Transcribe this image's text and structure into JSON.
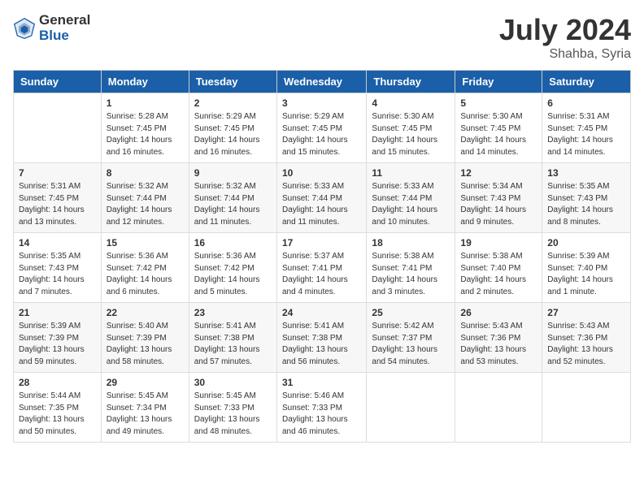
{
  "header": {
    "logo_general": "General",
    "logo_blue": "Blue",
    "title": "July 2024",
    "location": "Shahba, Syria"
  },
  "weekdays": [
    "Sunday",
    "Monday",
    "Tuesday",
    "Wednesday",
    "Thursday",
    "Friday",
    "Saturday"
  ],
  "weeks": [
    [
      {
        "day": "",
        "info": ""
      },
      {
        "day": "1",
        "info": "Sunrise: 5:28 AM\nSunset: 7:45 PM\nDaylight: 14 hours\nand 16 minutes."
      },
      {
        "day": "2",
        "info": "Sunrise: 5:29 AM\nSunset: 7:45 PM\nDaylight: 14 hours\nand 16 minutes."
      },
      {
        "day": "3",
        "info": "Sunrise: 5:29 AM\nSunset: 7:45 PM\nDaylight: 14 hours\nand 15 minutes."
      },
      {
        "day": "4",
        "info": "Sunrise: 5:30 AM\nSunset: 7:45 PM\nDaylight: 14 hours\nand 15 minutes."
      },
      {
        "day": "5",
        "info": "Sunrise: 5:30 AM\nSunset: 7:45 PM\nDaylight: 14 hours\nand 14 minutes."
      },
      {
        "day": "6",
        "info": "Sunrise: 5:31 AM\nSunset: 7:45 PM\nDaylight: 14 hours\nand 14 minutes."
      }
    ],
    [
      {
        "day": "7",
        "info": "Sunrise: 5:31 AM\nSunset: 7:45 PM\nDaylight: 14 hours\nand 13 minutes."
      },
      {
        "day": "8",
        "info": "Sunrise: 5:32 AM\nSunset: 7:44 PM\nDaylight: 14 hours\nand 12 minutes."
      },
      {
        "day": "9",
        "info": "Sunrise: 5:32 AM\nSunset: 7:44 PM\nDaylight: 14 hours\nand 11 minutes."
      },
      {
        "day": "10",
        "info": "Sunrise: 5:33 AM\nSunset: 7:44 PM\nDaylight: 14 hours\nand 11 minutes."
      },
      {
        "day": "11",
        "info": "Sunrise: 5:33 AM\nSunset: 7:44 PM\nDaylight: 14 hours\nand 10 minutes."
      },
      {
        "day": "12",
        "info": "Sunrise: 5:34 AM\nSunset: 7:43 PM\nDaylight: 14 hours\nand 9 minutes."
      },
      {
        "day": "13",
        "info": "Sunrise: 5:35 AM\nSunset: 7:43 PM\nDaylight: 14 hours\nand 8 minutes."
      }
    ],
    [
      {
        "day": "14",
        "info": "Sunrise: 5:35 AM\nSunset: 7:43 PM\nDaylight: 14 hours\nand 7 minutes."
      },
      {
        "day": "15",
        "info": "Sunrise: 5:36 AM\nSunset: 7:42 PM\nDaylight: 14 hours\nand 6 minutes."
      },
      {
        "day": "16",
        "info": "Sunrise: 5:36 AM\nSunset: 7:42 PM\nDaylight: 14 hours\nand 5 minutes."
      },
      {
        "day": "17",
        "info": "Sunrise: 5:37 AM\nSunset: 7:41 PM\nDaylight: 14 hours\nand 4 minutes."
      },
      {
        "day": "18",
        "info": "Sunrise: 5:38 AM\nSunset: 7:41 PM\nDaylight: 14 hours\nand 3 minutes."
      },
      {
        "day": "19",
        "info": "Sunrise: 5:38 AM\nSunset: 7:40 PM\nDaylight: 14 hours\nand 2 minutes."
      },
      {
        "day": "20",
        "info": "Sunrise: 5:39 AM\nSunset: 7:40 PM\nDaylight: 14 hours\nand 1 minute."
      }
    ],
    [
      {
        "day": "21",
        "info": "Sunrise: 5:39 AM\nSunset: 7:39 PM\nDaylight: 13 hours\nand 59 minutes."
      },
      {
        "day": "22",
        "info": "Sunrise: 5:40 AM\nSunset: 7:39 PM\nDaylight: 13 hours\nand 58 minutes."
      },
      {
        "day": "23",
        "info": "Sunrise: 5:41 AM\nSunset: 7:38 PM\nDaylight: 13 hours\nand 57 minutes."
      },
      {
        "day": "24",
        "info": "Sunrise: 5:41 AM\nSunset: 7:38 PM\nDaylight: 13 hours\nand 56 minutes."
      },
      {
        "day": "25",
        "info": "Sunrise: 5:42 AM\nSunset: 7:37 PM\nDaylight: 13 hours\nand 54 minutes."
      },
      {
        "day": "26",
        "info": "Sunrise: 5:43 AM\nSunset: 7:36 PM\nDaylight: 13 hours\nand 53 minutes."
      },
      {
        "day": "27",
        "info": "Sunrise: 5:43 AM\nSunset: 7:36 PM\nDaylight: 13 hours\nand 52 minutes."
      }
    ],
    [
      {
        "day": "28",
        "info": "Sunrise: 5:44 AM\nSunset: 7:35 PM\nDaylight: 13 hours\nand 50 minutes."
      },
      {
        "day": "29",
        "info": "Sunrise: 5:45 AM\nSunset: 7:34 PM\nDaylight: 13 hours\nand 49 minutes."
      },
      {
        "day": "30",
        "info": "Sunrise: 5:45 AM\nSunset: 7:33 PM\nDaylight: 13 hours\nand 48 minutes."
      },
      {
        "day": "31",
        "info": "Sunrise: 5:46 AM\nSunset: 7:33 PM\nDaylight: 13 hours\nand 46 minutes."
      },
      {
        "day": "",
        "info": ""
      },
      {
        "day": "",
        "info": ""
      },
      {
        "day": "",
        "info": ""
      }
    ]
  ]
}
